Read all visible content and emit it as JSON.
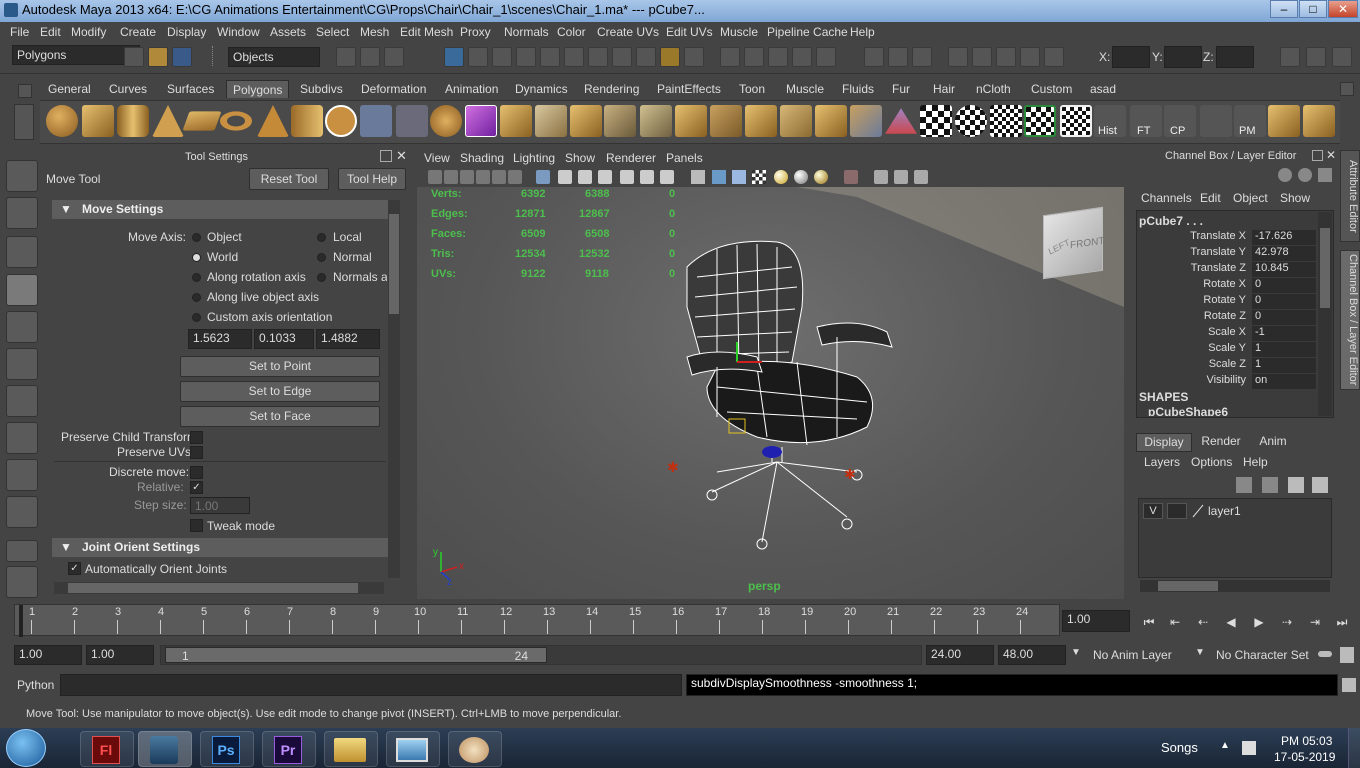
{
  "window": {
    "title": "Autodesk Maya 2013 x64: E:\\CG Animations Entertainment\\CG\\Props\\Chair\\Chair_1\\scenes\\Chair_1.ma*   ---   pCube7...",
    "min_glyph": "–",
    "max_glyph": "□",
    "close_glyph": "✕"
  },
  "menubar": [
    "File",
    "Edit",
    "Modify",
    "Create",
    "Display",
    "Window",
    "Assets",
    "Select",
    "Mesh",
    "Edit Mesh",
    "Proxy",
    "Normals",
    "Color",
    "Create UVs",
    "Edit UVs",
    "Muscle",
    "Pipeline Cache",
    "Help"
  ],
  "statusline": {
    "mode": "Polygons",
    "selection_mode": "Objects",
    "x_label": "X:",
    "y_label": "Y:",
    "z_label": "Z:"
  },
  "shelf_tabs": [
    "General",
    "Curves",
    "Surfaces",
    "Polygons",
    "Subdivs",
    "Deformation",
    "Animation",
    "Dynamics",
    "Rendering",
    "PaintEffects",
    "Toon",
    "Muscle",
    "Fluids",
    "Fur",
    "Hair",
    "nCloth",
    "Custom",
    "asad"
  ],
  "shelf_active_tab": "Polygons",
  "shelf_text_icons": [
    "Hist",
    "FT",
    "CP",
    "PM"
  ],
  "tool_settings": {
    "panel_title": "Tool Settings",
    "tool_name": "Move Tool",
    "reset_button": "Reset Tool",
    "help_button": "Tool Help",
    "move_settings_header": "Move Settings",
    "move_axis_label": "Move Axis:",
    "axis_options": [
      {
        "label": "Object",
        "selected": false
      },
      {
        "label": "Local",
        "selected": false
      },
      {
        "label": "World",
        "selected": true
      },
      {
        "label": "Normal",
        "selected": false
      },
      {
        "label": "Along rotation axis",
        "selected": false
      },
      {
        "label": "Normals av",
        "selected": false
      },
      {
        "label": "Along live object axis",
        "selected": false
      },
      {
        "label": "Custom axis orientation",
        "selected": false
      }
    ],
    "custom_values": [
      "1.5623",
      "0.1033",
      "1.4882"
    ],
    "set_to_point": "Set to Point",
    "set_to_edge": "Set to Edge",
    "set_to_face": "Set to Face",
    "preserve_child": "Preserve Child Transform",
    "preserve_uvs": "Preserve UVs",
    "discrete_move": "Discrete move:",
    "relative": "Relative:",
    "step_size": "Step size:",
    "step_value": "1.00",
    "tweak_mode": "Tweak mode",
    "joint_orient_header": "Joint Orient Settings",
    "auto_orient": "Automatically Orient Joints"
  },
  "viewport": {
    "menu": [
      "View",
      "Shading",
      "Lighting",
      "Show",
      "Renderer",
      "Panels"
    ],
    "camera_label": "persp",
    "viewcube_front": "FRONT",
    "viewcube_left": "LEFT",
    "hud_rows": [
      {
        "label": "Verts:",
        "a": "6392",
        "b": "6388",
        "c": "0"
      },
      {
        "label": "Edges:",
        "a": "12871",
        "b": "12867",
        "c": "0"
      },
      {
        "label": "Faces:",
        "a": "6509",
        "b": "6508",
        "c": "0"
      },
      {
        "label": "Tris:",
        "a": "12534",
        "b": "12532",
        "c": "0"
      },
      {
        "label": "UVs:",
        "a": "9122",
        "b": "9118",
        "c": "0"
      }
    ],
    "hud_color": "#4dbf4d",
    "axis_labels": {
      "x": "x",
      "y": "y",
      "z": "z"
    }
  },
  "channel_box": {
    "title": "Channel Box / Layer Editor",
    "menu": [
      "Channels",
      "Edit",
      "Object",
      "Show"
    ],
    "object_name": "pCube7 . . .",
    "attributes": [
      {
        "name": "Translate X",
        "value": "-17.626"
      },
      {
        "name": "Translate Y",
        "value": "42.978"
      },
      {
        "name": "Translate Z",
        "value": "10.845"
      },
      {
        "name": "Rotate X",
        "value": "0"
      },
      {
        "name": "Rotate Y",
        "value": "0"
      },
      {
        "name": "Rotate Z",
        "value": "0"
      },
      {
        "name": "Scale X",
        "value": "-1"
      },
      {
        "name": "Scale Y",
        "value": "1"
      },
      {
        "name": "Scale Z",
        "value": "1"
      },
      {
        "name": "Visibility",
        "value": "on"
      }
    ],
    "shapes_label": "SHAPES",
    "shape_name": "pCubeShape6",
    "layer_tabs": [
      "Display",
      "Render",
      "Anim"
    ],
    "layer_menu": [
      "Layers",
      "Options",
      "Help"
    ],
    "layer_visible": "V",
    "layer_name": "layer1",
    "side_tab_attr": "Attribute Editor",
    "side_tab_cb": "Channel Box / Layer Editor"
  },
  "time_slider": {
    "ticks": [
      "1",
      "2",
      "3",
      "4",
      "5",
      "6",
      "7",
      "8",
      "9",
      "10",
      "11",
      "12",
      "13",
      "14",
      "15",
      "16",
      "17",
      "18",
      "19",
      "20",
      "21",
      "22",
      "23",
      "24"
    ],
    "current_frame": "1.00"
  },
  "range_slider": {
    "start": "1.00",
    "start2": "1.00",
    "inner_start": "1",
    "inner_end": "24",
    "end": "24.00",
    "end2": "48.00",
    "anim_layer": "No Anim Layer",
    "character_set": "No Character Set"
  },
  "command_line": {
    "language": "Python",
    "result": "subdivDisplaySmoothness -smoothness 1;"
  },
  "help_line": "Move Tool: Use manipulator to move object(s). Use edit mode to change pivot (INSERT).  Ctrl+LMB to move perpendicular.",
  "taskbar": {
    "apps": [
      "Flash",
      "Maya",
      "Photoshop",
      "Premiere",
      "File Explorer",
      "Screen Capture",
      "Paint"
    ],
    "app_glyphs": [
      "Fl",
      "",
      "Ps",
      "Pr",
      "",
      "",
      ""
    ],
    "tray_label": "Songs",
    "time": "PM 05:03",
    "date": "17-05-2019"
  }
}
